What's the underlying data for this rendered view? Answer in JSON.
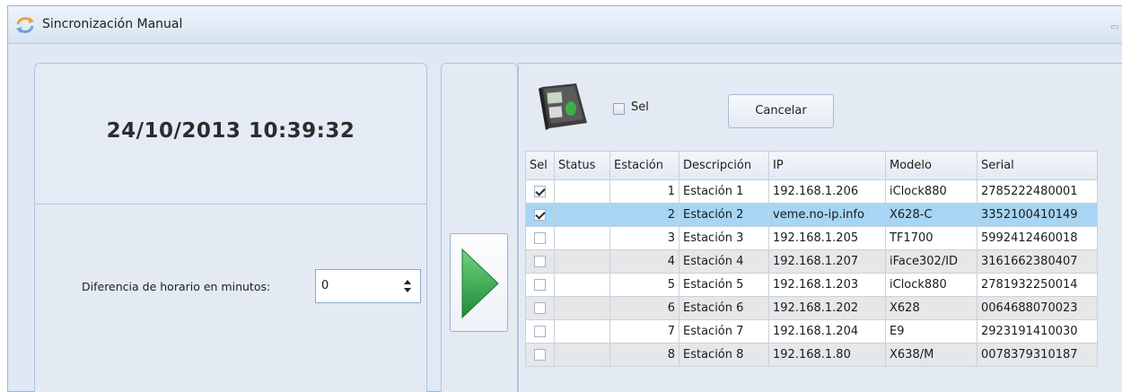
{
  "window": {
    "title": "Sincronización Manual"
  },
  "clock": {
    "datetime": "24/10/2013 10:39:32"
  },
  "offset": {
    "label": "Diferencia de horario en minutos:",
    "value": "0"
  },
  "toolbar": {
    "sel_label": "Sel",
    "cancel_label": "Cancelar"
  },
  "grid": {
    "columns": [
      "Sel",
      "Status",
      "Estación",
      "Descripción",
      "IP",
      "Modelo",
      "Serial"
    ],
    "rows": [
      {
        "checked": true,
        "status": "",
        "estacion": "1",
        "descripcion": "Estación 1",
        "ip": "192.168.1.206",
        "modelo": "iClock880",
        "serial": "2785222480001"
      },
      {
        "checked": true,
        "status": "",
        "estacion": "2",
        "descripcion": "Estación 2",
        "ip": "veme.no-ip.info",
        "modelo": "X628-C",
        "serial": "3352100410149"
      },
      {
        "checked": false,
        "status": "",
        "estacion": "3",
        "descripcion": "Estación 3",
        "ip": "192.168.1.205",
        "modelo": "TF1700",
        "serial": "5992412460018"
      },
      {
        "checked": false,
        "status": "",
        "estacion": "4",
        "descripcion": "Estación 4",
        "ip": "192.168.1.207",
        "modelo": "iFace302/ID",
        "serial": "3161662380407"
      },
      {
        "checked": false,
        "status": "",
        "estacion": "5",
        "descripcion": "Estación 5",
        "ip": "192.168.1.203",
        "modelo": "iClock880",
        "serial": "2781932250014"
      },
      {
        "checked": false,
        "status": "",
        "estacion": "6",
        "descripcion": "Estación 6",
        "ip": "192.168.1.202",
        "modelo": "X628",
        "serial": "0064688070023"
      },
      {
        "checked": false,
        "status": "",
        "estacion": "7",
        "descripcion": "Estación 7",
        "ip": "192.168.1.204",
        "modelo": "E9",
        "serial": "2923191410030"
      },
      {
        "checked": false,
        "status": "",
        "estacion": "8",
        "descripcion": "Estación 8",
        "ip": "192.168.1.80",
        "modelo": "X638/M",
        "serial": "0078379310187"
      }
    ],
    "selected_row": 2
  },
  "colors": {
    "selected_row": "#a7d5f3",
    "alt_row": "#e6e7e9",
    "arrow": "#2fa34a"
  },
  "icons": {
    "title": "sync-icon",
    "device": "fingerprint-terminal-icon",
    "run": "play-arrow-icon"
  }
}
